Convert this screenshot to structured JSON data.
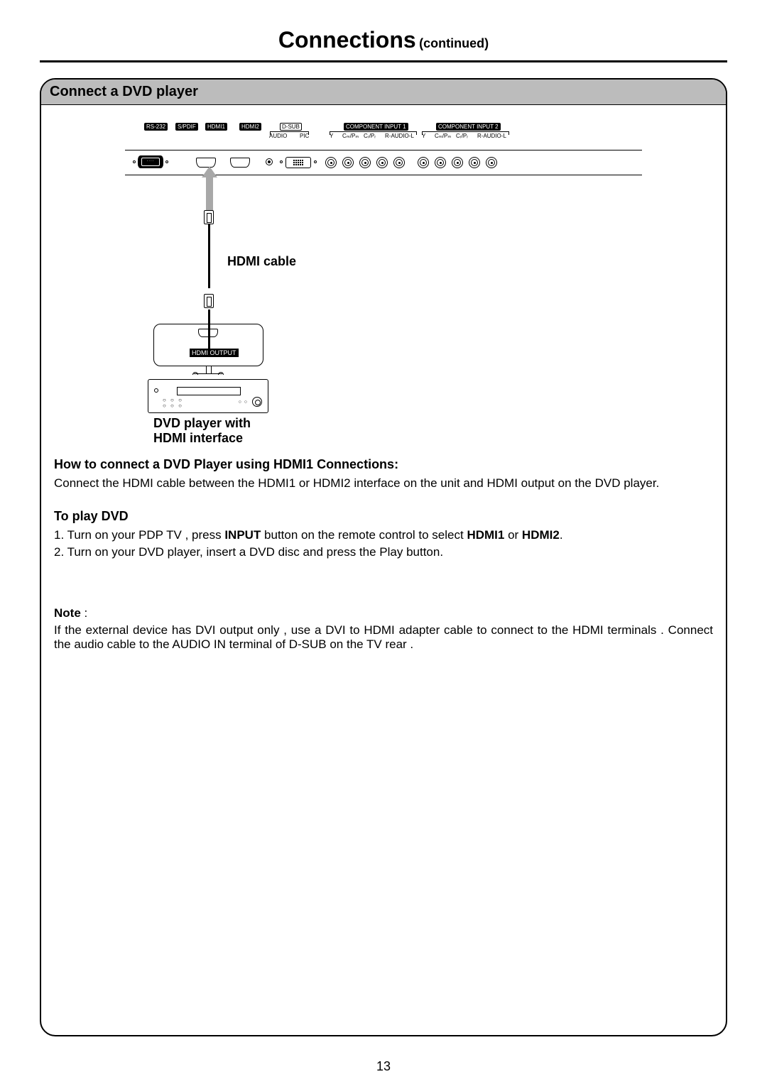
{
  "page": {
    "title_main": "Connections",
    "title_sub": "(continued)",
    "number": "13"
  },
  "section": {
    "header": "Connect a DVD player"
  },
  "diagram": {
    "port_labels": {
      "rs232": "RS-232",
      "spdif": "S/PDIF",
      "hdmi1": "HDMI1",
      "hdmi2": "HDMI2",
      "dsub": "D-SUB",
      "audio": "AUDIO",
      "pic": "PIC",
      "comp1": "COMPONENT INPUT 1",
      "comp2": "COMPONENT INPUT 2",
      "comp_pins_y": "Y",
      "comp_pins_cb": "Cₘ/Pₘ",
      "comp_pins_cr": "Cᵣ/Pᵣ",
      "comp_pins_audio": "R-AUDIO-L"
    },
    "hdmi_cable_label": "HDMI cable",
    "hdmi_output_label": "HDMI OUTPUT",
    "dvd_caption_line1": "DVD player with",
    "dvd_caption_line2": "HDMI interface"
  },
  "text": {
    "howto_heading": "How to connect a DVD Player using HDMI1 Connections:",
    "howto_body": "Connect the HDMI cable between the HDMI1 or HDMI2 interface on the unit and HDMI output on the DVD player.",
    "play_heading": "To play DVD",
    "play_step1_pre": "1. Turn on your PDP TV , press ",
    "play_step1_b1": "INPUT",
    "play_step1_mid": " button on the remote control to select ",
    "play_step1_b2": "HDMI1",
    "play_step1_or": " or ",
    "play_step1_b3": "HDMI2",
    "play_step1_end": ".",
    "play_step2": "2. Turn on your DVD player, insert a DVD disc and press the Play button.",
    "note_label": "Note",
    "note_colon": " :",
    "note_body": "If the external device has DVI output only , use a DVI to HDMI adapter cable to connect to the HDMI terminals . Connect the audio cable to the AUDIO IN terminal of D-SUB on the TV rear ."
  }
}
